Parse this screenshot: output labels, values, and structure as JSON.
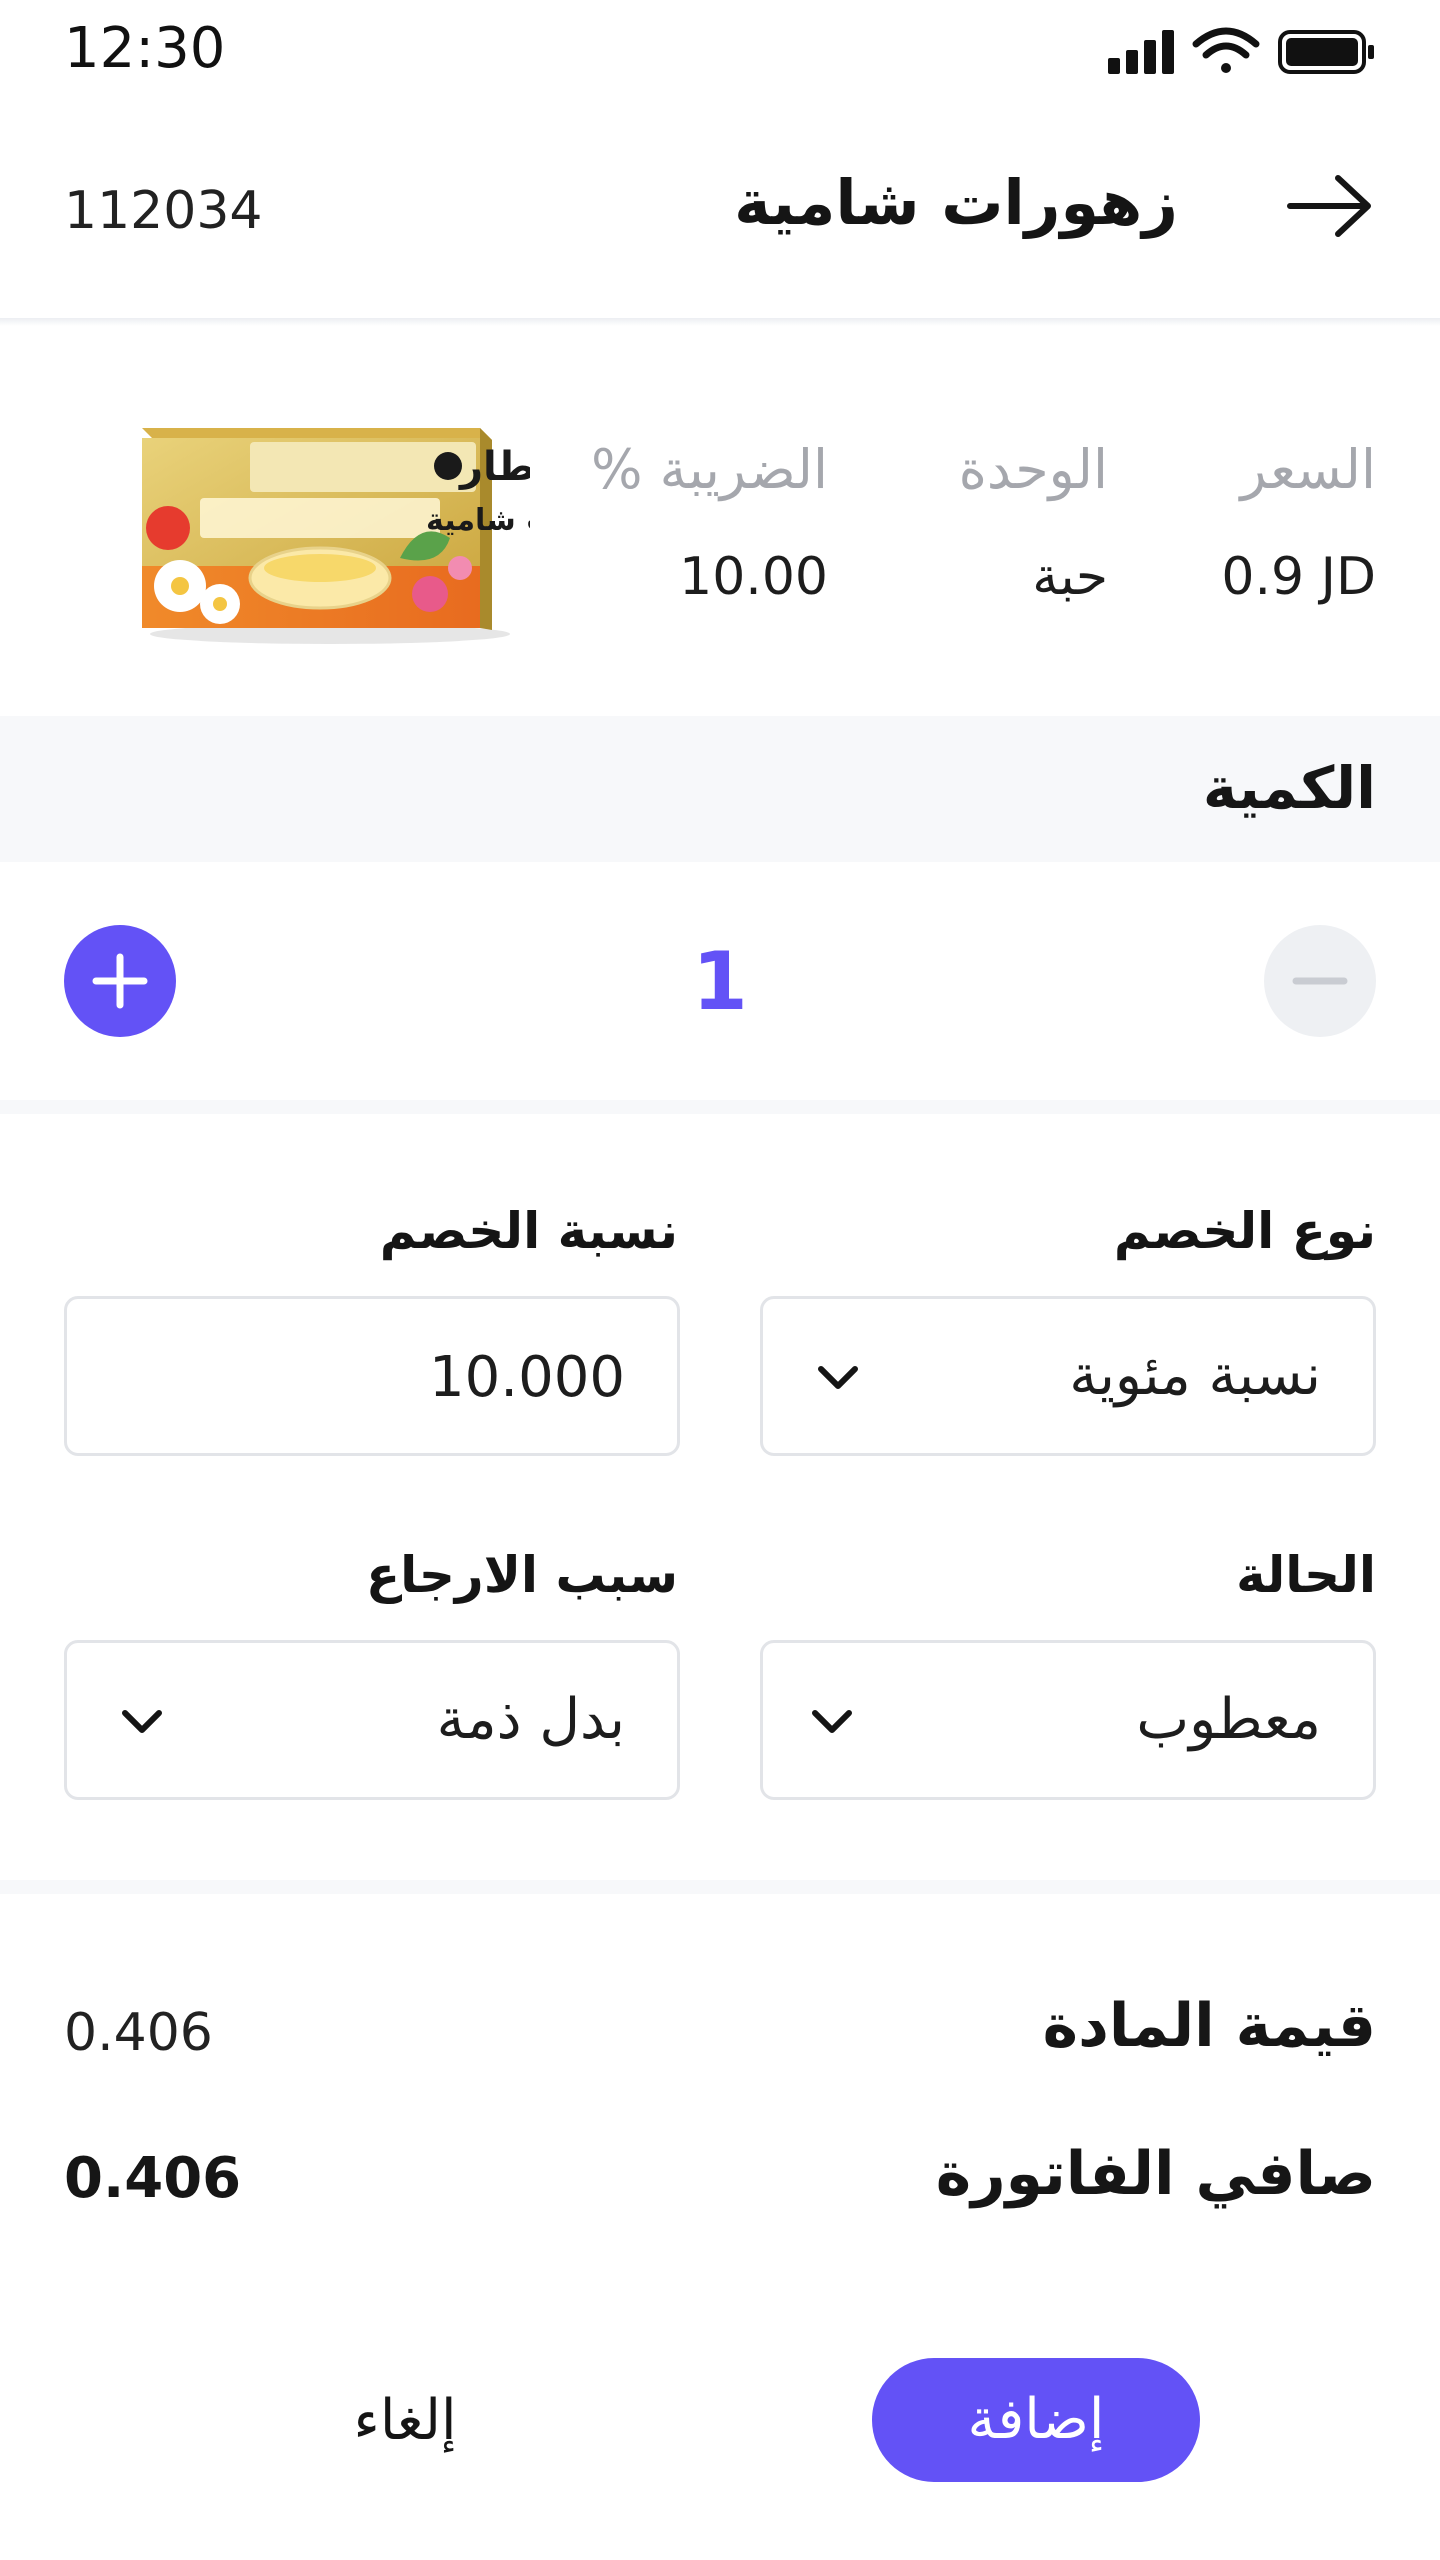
{
  "status_bar": {
    "time": "12:30"
  },
  "header": {
    "order_code": "112034",
    "title": "زهورات شامية",
    "back_icon": "arrow-right-icon"
  },
  "product": {
    "price_label": "السعر",
    "price_value": "0.9 JD",
    "unit_label": "الوحدة",
    "unit_value": "حبة",
    "tax_label": "الضريبة %",
    "tax_value": "10.00",
    "image": {
      "brand": "العطار",
      "name": "زهورات شامية"
    }
  },
  "quantity": {
    "title": "الكمية",
    "value": "1",
    "plus_icon": "plus-icon",
    "minus_icon": "minus-icon"
  },
  "form": {
    "discount_type_label": "نوع الخصم",
    "discount_type_value": "نسبة مئوية",
    "discount_rate_label": "نسبة الخصم",
    "discount_rate_value": "10.000",
    "status_label": "الحالة",
    "status_value": "معطوب",
    "return_reason_label": "سبب الارجاع",
    "return_reason_value": "بدل ذمة"
  },
  "totals": {
    "item_value_label": "قيمة المادة",
    "item_value": "0.406",
    "net_total_label": "صافي الفاتورة",
    "net_total": "0.406"
  },
  "actions": {
    "add_label": "إضافة",
    "cancel_label": "إلغاء"
  },
  "colors": {
    "accent": "#6352f6",
    "muted_label": "#a5a7ad",
    "band": "#f7f8fa",
    "border": "#e2e4e8"
  }
}
